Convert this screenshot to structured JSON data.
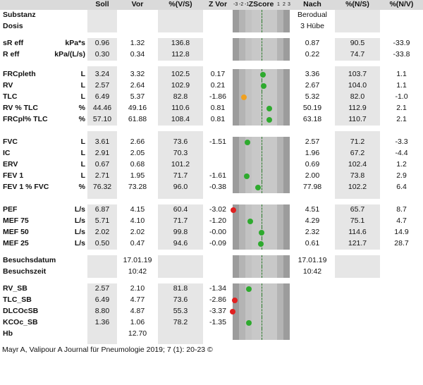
{
  "headers": [
    "",
    "Soll",
    "Vor",
    "%(V/S)",
    "Z Vor",
    "ZScore",
    "Nach",
    "%(N/S)",
    "%(N/V)"
  ],
  "zscale": [
    "-3",
    "-2",
    "-1",
    "1",
    "2",
    "3"
  ],
  "colors": {
    "green": "#2eaa2e",
    "orange": "#f0a020",
    "red": "#e02020",
    "stripe": "#e6e6e6"
  },
  "rows": [
    {
      "label": "Substanz",
      "unit": "",
      "soll": "",
      "vor": "",
      "vs": "",
      "zvor": "",
      "nach": "Berodual",
      "ns": "",
      "nv": ""
    },
    {
      "label": "Dosis",
      "unit": "",
      "soll": "",
      "vor": "",
      "vs": "",
      "zvor": "",
      "nach": "3 Hübe",
      "ns": "",
      "nv": ""
    },
    {
      "label": "sR eff",
      "unit": "kPa*s",
      "soll": "0.96",
      "vor": "1.32",
      "vs": "136.8",
      "zvor": "",
      "nach": "0.87",
      "ns": "90.5",
      "nv": "-33.9"
    },
    {
      "label": "R eff",
      "unit": "kPa/(L/s)",
      "soll": "0.30",
      "vor": "0.34",
      "vs": "112.8",
      "zvor": "",
      "nach": "0.22",
      "ns": "74.7",
      "nv": "-33.8"
    },
    {
      "label": "FRCpleth",
      "unit": "L",
      "soll": "3.24",
      "vor": "3.32",
      "vs": "102.5",
      "zvor": "0.17",
      "z": 0.17,
      "dot": "green",
      "nach": "3.36",
      "ns": "103.7",
      "nv": "1.1"
    },
    {
      "label": "RV",
      "unit": "L",
      "soll": "2.57",
      "vor": "2.64",
      "vs": "102.9",
      "zvor": "0.21",
      "z": 0.21,
      "dot": "green",
      "nach": "2.67",
      "ns": "104.0",
      "nv": "1.1"
    },
    {
      "label": "TLC",
      "unit": "L",
      "soll": "6.49",
      "vor": "5.37",
      "vs": "82.8",
      "zvor": "-1.86",
      "z": -1.86,
      "dot": "orange",
      "nach": "5.32",
      "ns": "82.0",
      "nv": "-1.0"
    },
    {
      "label": "RV % TLC",
      "unit": "%",
      "soll": "44.46",
      "vor": "49.16",
      "vs": "110.6",
      "zvor": "0.81",
      "z": 0.81,
      "dot": "green",
      "nach": "50.19",
      "ns": "112.9",
      "nv": "2.1"
    },
    {
      "label": "FRCpl% TLC",
      "unit": "%",
      "soll": "57.10",
      "vor": "61.88",
      "vs": "108.4",
      "zvor": "0.81",
      "z": 0.81,
      "dot": "green",
      "nach": "63.18",
      "ns": "110.7",
      "nv": "2.1"
    },
    {
      "label": "FVC",
      "unit": "L",
      "soll": "3.61",
      "vor": "2.66",
      "vs": "73.6",
      "zvor": "-1.51",
      "z": -1.51,
      "dot": "green",
      "nach": "2.57",
      "ns": "71.2",
      "nv": "-3.3"
    },
    {
      "label": "IC",
      "unit": "L",
      "soll": "2.91",
      "vor": "2.05",
      "vs": "70.3",
      "zvor": "",
      "nach": "1.96",
      "ns": "67.2",
      "nv": "-4.4"
    },
    {
      "label": "ERV",
      "unit": "L",
      "soll": "0.67",
      "vor": "0.68",
      "vs": "101.2",
      "zvor": "",
      "nach": "0.69",
      "ns": "102.4",
      "nv": "1.2"
    },
    {
      "label": "FEV 1",
      "unit": "L",
      "soll": "2.71",
      "vor": "1.95",
      "vs": "71.7",
      "zvor": "-1.61",
      "z": -1.61,
      "dot": "green",
      "nach": "2.00",
      "ns": "73.8",
      "nv": "2.9"
    },
    {
      "label": "FEV 1 % FVC",
      "unit": "%",
      "soll": "76.32",
      "vor": "73.28",
      "vs": "96.0",
      "zvor": "-0.38",
      "z": -0.38,
      "dot": "green",
      "nach": "77.98",
      "ns": "102.2",
      "nv": "6.4"
    },
    {
      "label": "PEF",
      "unit": "L/s",
      "soll": "6.87",
      "vor": "4.15",
      "vs": "60.4",
      "zvor": "-3.02",
      "z": -3.02,
      "dot": "red",
      "nach": "4.51",
      "ns": "65.7",
      "nv": "8.7"
    },
    {
      "label": "MEF 75",
      "unit": "L/s",
      "soll": "5.71",
      "vor": "4.10",
      "vs": "71.7",
      "zvor": "-1.20",
      "z": -1.2,
      "dot": "green",
      "nach": "4.29",
      "ns": "75.1",
      "nv": "4.7"
    },
    {
      "label": "MEF 50",
      "unit": "L/s",
      "soll": "2.02",
      "vor": "2.02",
      "vs": "99.8",
      "zvor": "-0.00",
      "z": 0.0,
      "dot": "green",
      "nach": "2.32",
      "ns": "114.6",
      "nv": "14.9"
    },
    {
      "label": "MEF 25",
      "unit": "L/s",
      "soll": "0.50",
      "vor": "0.47",
      "vs": "94.6",
      "zvor": "-0.09",
      "z": -0.09,
      "dot": "green",
      "nach": "0.61",
      "ns": "121.7",
      "nv": "28.7"
    },
    {
      "label": "Besuchsdatum",
      "unit": "",
      "soll": "",
      "vor": "17.01.19",
      "vs": "",
      "zvor": "",
      "nach": "17.01.19",
      "ns": "",
      "nv": ""
    },
    {
      "label": "Besuchszeit",
      "unit": "",
      "soll": "",
      "vor": "10:42",
      "vs": "",
      "zvor": "",
      "nach": "10:42",
      "ns": "",
      "nv": ""
    },
    {
      "label": "RV_SB",
      "unit": "",
      "soll": "2.57",
      "vor": "2.10",
      "vs": "81.8",
      "zvor": "-1.34",
      "z": -1.34,
      "dot": "green",
      "nach": "",
      "ns": "",
      "nv": ""
    },
    {
      "label": "TLC_SB",
      "unit": "",
      "soll": "6.49",
      "vor": "4.77",
      "vs": "73.6",
      "zvor": "-2.86",
      "z": -2.86,
      "dot": "red",
      "nach": "",
      "ns": "",
      "nv": ""
    },
    {
      "label": "DLCOcSB",
      "unit": "",
      "soll": "8.80",
      "vor": "4.87",
      "vs": "55.3",
      "zvor": "-3.37",
      "z": -3.37,
      "dot": "red",
      "nach": "",
      "ns": "",
      "nv": ""
    },
    {
      "label": "KCOc_SB",
      "unit": "",
      "soll": "1.36",
      "vor": "1.06",
      "vs": "78.2",
      "zvor": "-1.35",
      "z": -1.35,
      "dot": "green",
      "nach": "",
      "ns": "",
      "nv": ""
    },
    {
      "label": "Hb",
      "unit": "",
      "soll": "",
      "vor": "12.70",
      "vs": "",
      "zvor": "",
      "nach": "",
      "ns": "",
      "nv": ""
    }
  ],
  "caption": "Mayr A, Valipour A Journal für Pneumologie 2019; 7 (1): 20-23 ©"
}
